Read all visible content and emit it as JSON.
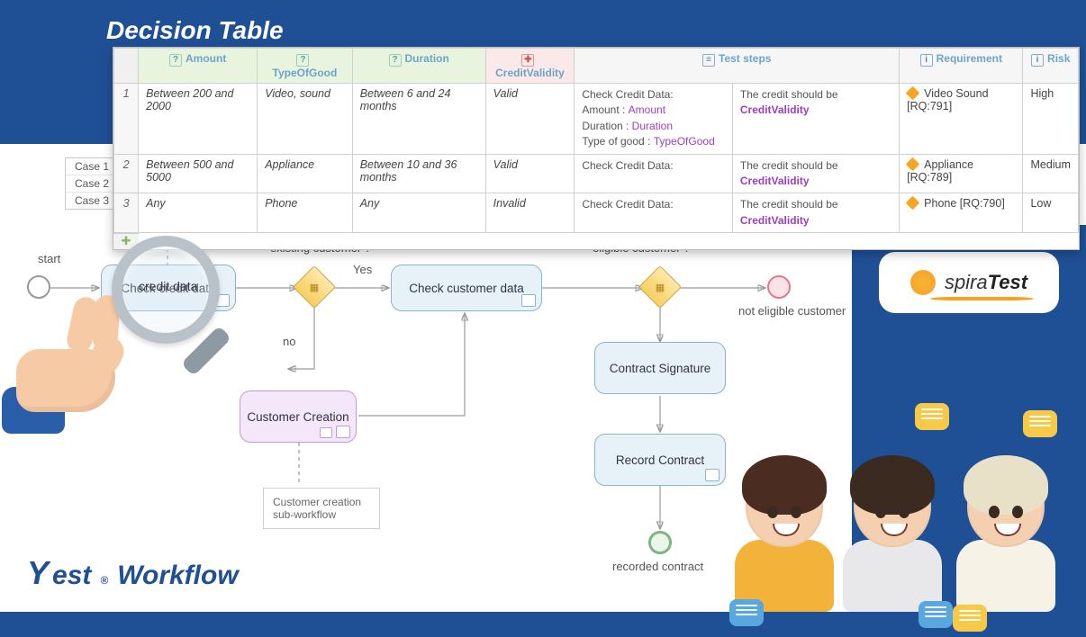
{
  "title": "Decision Table",
  "table": {
    "headers": {
      "amount": "Amount",
      "typeOfGood": "TypeOfGood",
      "duration": "Duration",
      "creditValidity": "CreditValidity",
      "testSteps": "Test steps",
      "requirement": "Requirement",
      "risk": "Risk"
    },
    "rows": [
      {
        "idx": "1",
        "amount": "Between 200 and 2000",
        "typeOfGood": "Video, sound",
        "duration": "Between 6 and 24 months",
        "validity": "Valid",
        "steps_header": "Check Credit Data:",
        "steps_amount_label": "Amount : ",
        "steps_amount_kw": "Amount",
        "steps_duration_label": "Duration : ",
        "steps_duration_kw": "Duration",
        "steps_type_label": "Type of good : ",
        "steps_type_kw": "TypeOfGood",
        "expected_prefix": "The credit should be ",
        "expected_kw": "CreditValidity",
        "requirement": "Video Sound [RQ:791]",
        "risk": "High"
      },
      {
        "idx": "2",
        "amount": "Between 500 and 5000",
        "typeOfGood": "Appliance",
        "duration": "Between 10 and 36 months",
        "validity": "Valid",
        "steps_header": "Check Credit Data:",
        "expected_prefix": "The credit should be ",
        "expected_kw": "CreditValidity",
        "requirement": "Appliance [RQ:789]",
        "risk": "Medium"
      },
      {
        "idx": "3",
        "amount": "Any",
        "typeOfGood": "Phone",
        "duration": "Any",
        "validity": "Invalid",
        "steps_header": "Check Credit Data:",
        "expected_prefix": "The credit should be ",
        "expected_kw": "CreditValidity",
        "requirement": "Phone [RQ:790]",
        "risk": "Low"
      }
    ]
  },
  "cases": {
    "c1": "Case 1",
    "c2": "Case 2",
    "c3": "Case 3"
  },
  "diagram": {
    "start": "start",
    "checkCredit": "Check credit data",
    "existingQ": "existing customer ?",
    "yes": "Yes",
    "no": "no",
    "checkCustomer": "Check customer data",
    "eligibleQ": "eligible customer ?",
    "notEligible": "not eligible customer",
    "contractSig": "Contract Signature",
    "recordContract": "Record Contract",
    "recorded": "recorded contract",
    "custCreate": "Customer Creation",
    "custCreateNote": "Customer creation sub-workflow",
    "creditDataLens": "credit data"
  },
  "brands": {
    "yest": {
      "name": "Yest",
      "suffix": "Workflow"
    },
    "spira": {
      "prefix": "spira",
      "suffix": "Test"
    }
  }
}
